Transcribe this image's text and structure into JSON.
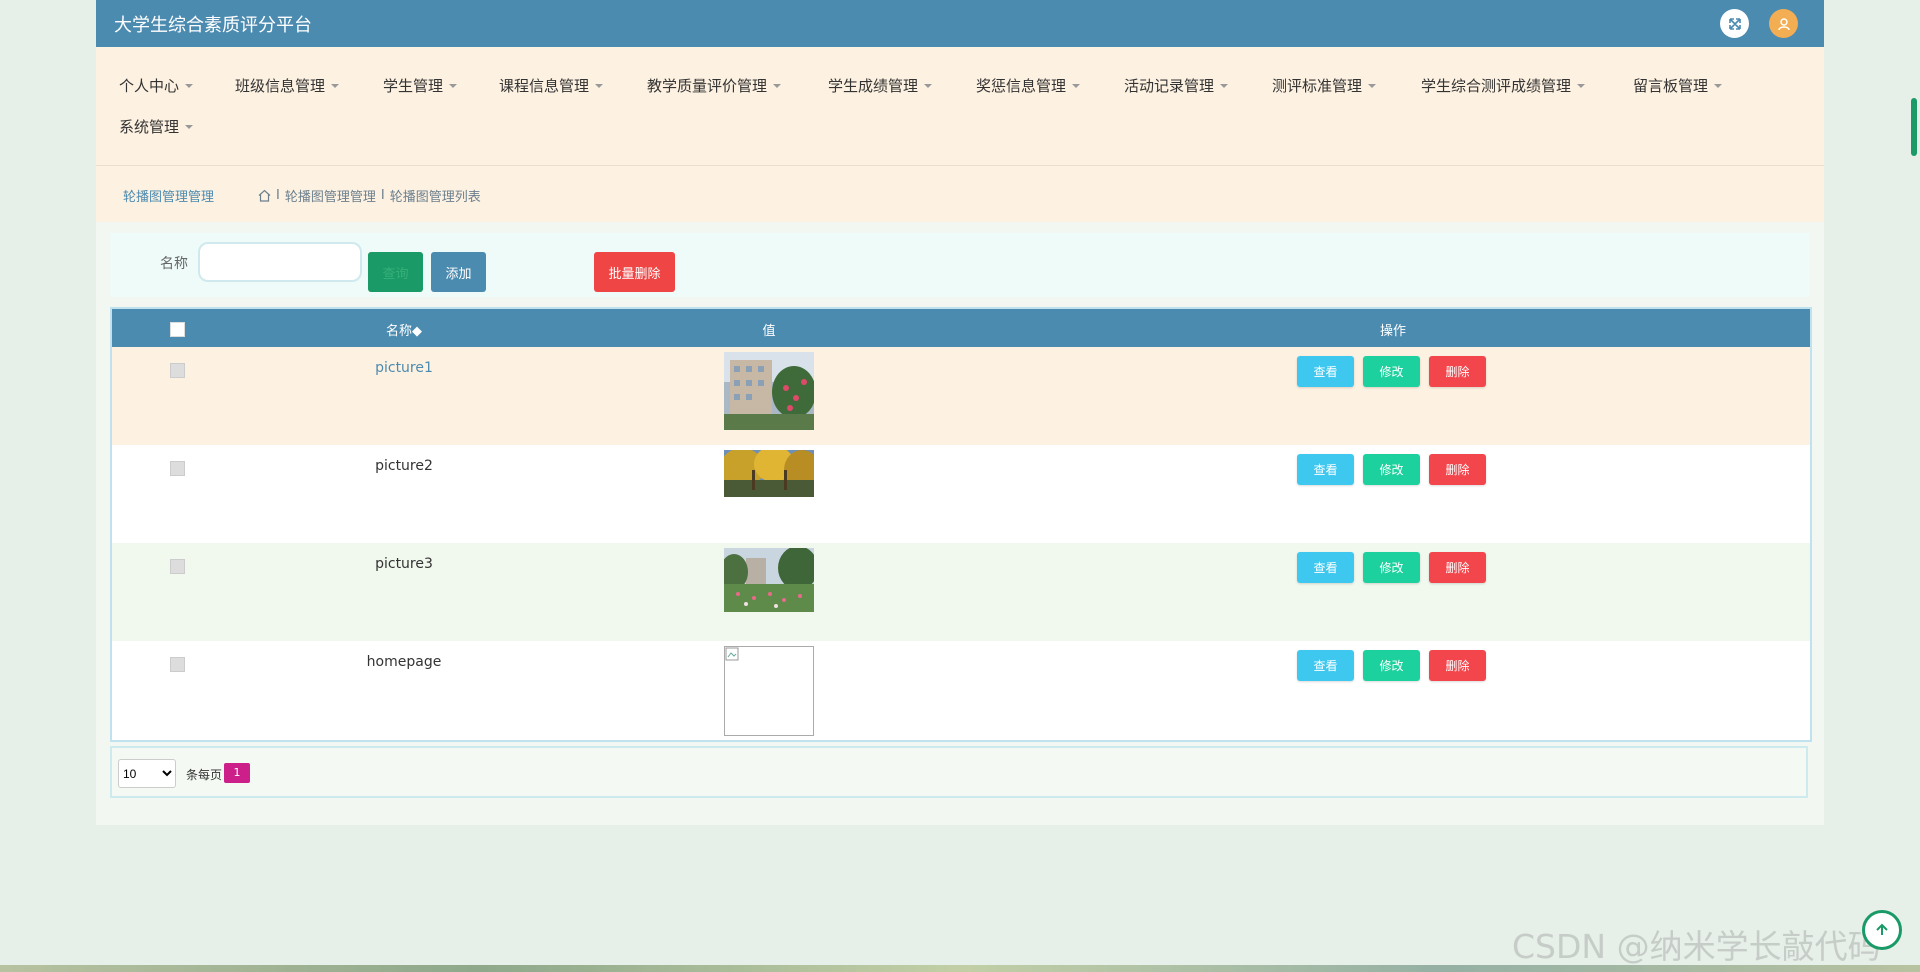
{
  "app": {
    "title": "大学生综合素质评分平台"
  },
  "menu": [
    {
      "label": "个人中心"
    },
    {
      "label": "班级信息管理"
    },
    {
      "label": "学生管理"
    },
    {
      "label": "课程信息管理"
    },
    {
      "label": "教学质量评价管理"
    },
    {
      "label": "学生成绩管理"
    },
    {
      "label": "奖惩信息管理"
    },
    {
      "label": "活动记录管理"
    },
    {
      "label": "测评标准管理"
    },
    {
      "label": "学生综合测评成绩管理"
    },
    {
      "label": "留言板管理"
    },
    {
      "label": "系统管理"
    }
  ],
  "breadcrumb": {
    "title": "轮播图管理管理",
    "sep": "I",
    "parent": "轮播图管理管理",
    "current": "轮播图管理列表"
  },
  "search": {
    "label": "名称",
    "value": "",
    "search_label": "查询",
    "add_label": "添加",
    "batch_delete_label": "批量删除"
  },
  "table": {
    "headers": {
      "name": "名称◆",
      "value": "值",
      "ops": "操作"
    },
    "rows": [
      {
        "name": "picture1",
        "image": "campus-building-flowers"
      },
      {
        "name": "picture2",
        "image": "autumn-trees"
      },
      {
        "name": "picture3",
        "image": "campus-garden"
      },
      {
        "name": "homepage",
        "image": "broken-image"
      }
    ],
    "ops": {
      "view": "查看",
      "edit": "修改",
      "del": "删除"
    }
  },
  "pager": {
    "size_value": "10",
    "per_page": "条每页",
    "current_page": "1"
  },
  "watermark": "CSDN @纳米学长敲代码",
  "colors": {
    "topbar": "#4c8bb0",
    "menubar": "#fdf1e1",
    "view": "#3ec8f0",
    "edit": "#1cd19e",
    "delete": "#f2454c",
    "page_badge": "#cc1f8a"
  }
}
